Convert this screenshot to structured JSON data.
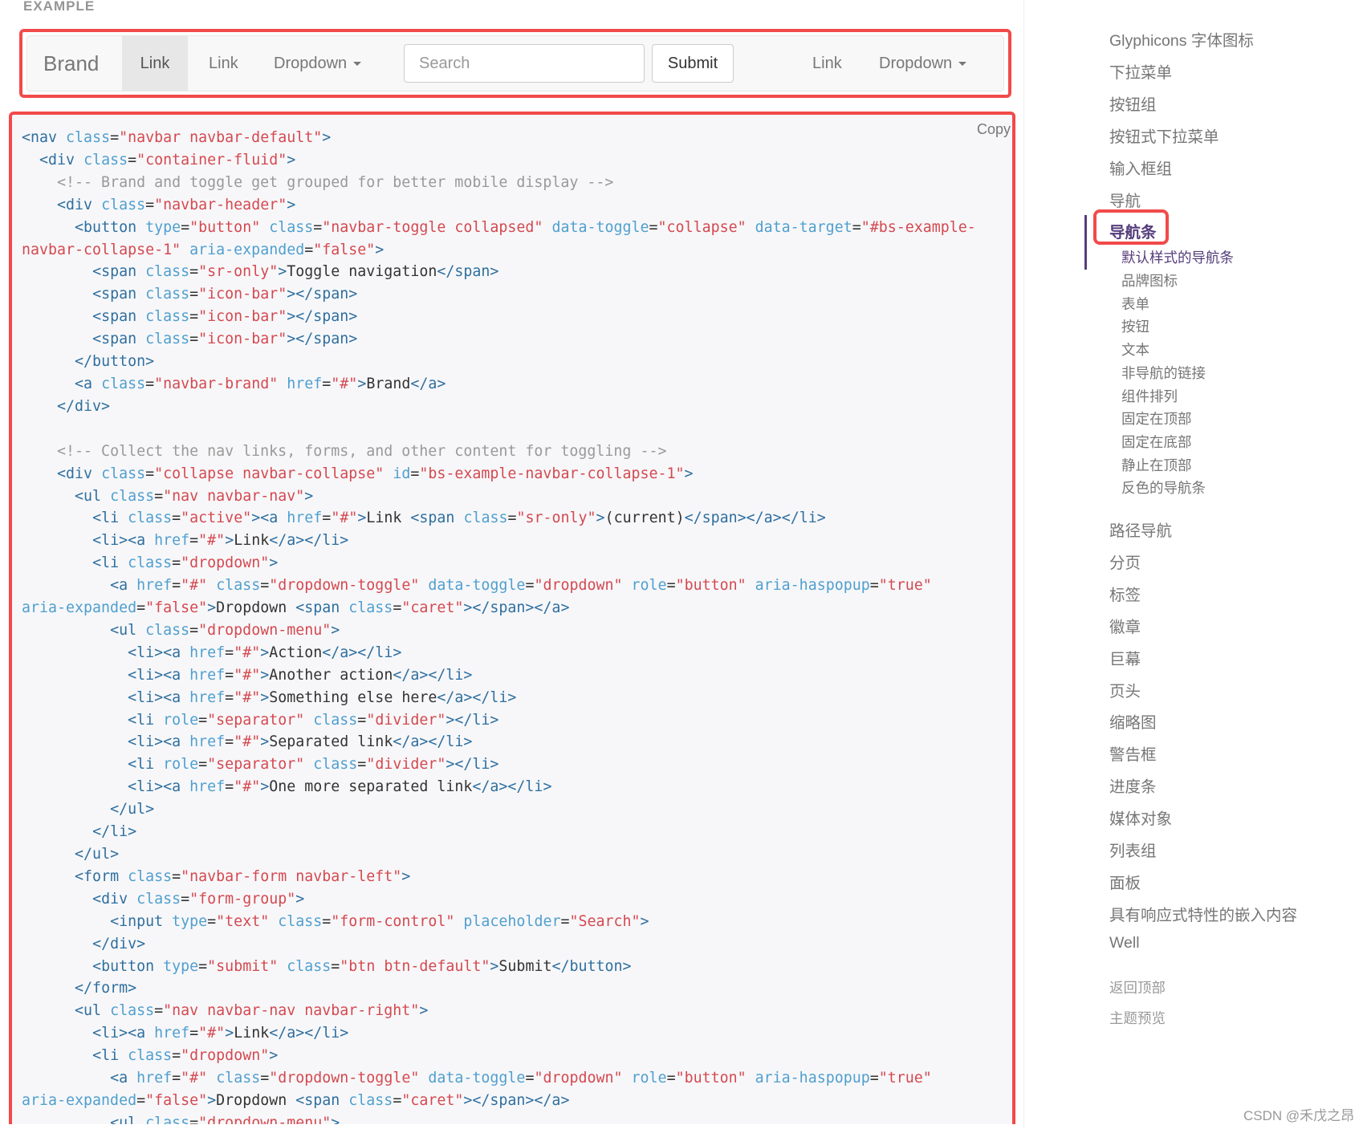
{
  "example_label": "EXAMPLE",
  "navbar": {
    "brand": "Brand",
    "links_left": [
      "Link",
      "Link"
    ],
    "dropdown_left": "Dropdown",
    "search_placeholder": "Search",
    "submit": "Submit",
    "link_right": "Link",
    "dropdown_right": "Dropdown"
  },
  "code": {
    "copy_label": "Copy",
    "lines": [
      "<nav class=\"navbar navbar-default\">",
      "  <div class=\"container-fluid\">",
      "    <!-- Brand and toggle get grouped for better mobile display -->",
      "    <div class=\"navbar-header\">",
      "      <button type=\"button\" class=\"navbar-toggle collapsed\" data-toggle=\"collapse\" data-target=\"#bs-example-",
      "navbar-collapse-1\" aria-expanded=\"false\">",
      "        <span class=\"sr-only\">Toggle navigation</span>",
      "        <span class=\"icon-bar\"></span>",
      "        <span class=\"icon-bar\"></span>",
      "        <span class=\"icon-bar\"></span>",
      "      </button>",
      "      <a class=\"navbar-brand\" href=\"#\">Brand</a>",
      "    </div>",
      "",
      "    <!-- Collect the nav links, forms, and other content for toggling -->",
      "    <div class=\"collapse navbar-collapse\" id=\"bs-example-navbar-collapse-1\">",
      "      <ul class=\"nav navbar-nav\">",
      "        <li class=\"active\"><a href=\"#\">Link <span class=\"sr-only\">(current)</span></a></li>",
      "        <li><a href=\"#\">Link</a></li>",
      "        <li class=\"dropdown\">",
      "          <a href=\"#\" class=\"dropdown-toggle\" data-toggle=\"dropdown\" role=\"button\" aria-haspopup=\"true\"",
      "aria-expanded=\"false\">Dropdown <span class=\"caret\"></span></a>",
      "          <ul class=\"dropdown-menu\">",
      "            <li><a href=\"#\">Action</a></li>",
      "            <li><a href=\"#\">Another action</a></li>",
      "            <li><a href=\"#\">Something else here</a></li>",
      "            <li role=\"separator\" class=\"divider\"></li>",
      "            <li><a href=\"#\">Separated link</a></li>",
      "            <li role=\"separator\" class=\"divider\"></li>",
      "            <li><a href=\"#\">One more separated link</a></li>",
      "          </ul>",
      "        </li>",
      "      </ul>",
      "      <form class=\"navbar-form navbar-left\">",
      "        <div class=\"form-group\">",
      "          <input type=\"text\" class=\"form-control\" placeholder=\"Search\">",
      "        </div>",
      "        <button type=\"submit\" class=\"btn btn-default\">Submit</button>",
      "      </form>",
      "      <ul class=\"nav navbar-nav navbar-right\">",
      "        <li><a href=\"#\">Link</a></li>",
      "        <li class=\"dropdown\">",
      "          <a href=\"#\" class=\"dropdown-toggle\" data-toggle=\"dropdown\" role=\"button\" aria-haspopup=\"true\"",
      "aria-expanded=\"false\">Dropdown <span class=\"caret\"></span></a>",
      "          <ul class=\"dropdown-menu\">"
    ],
    "colors": {
      "tag": "#2f6f9f",
      "attr": "#4f9fcf",
      "string": "#d44950",
      "comment": "#999999",
      "text": "#333333"
    }
  },
  "sidebar": {
    "items_top": [
      "Glyphicons 字体图标",
      "下拉菜单",
      "按钮组",
      "按钮式下拉菜单",
      "输入框组",
      "导航"
    ],
    "active_item": "导航条",
    "active_sub": "默认样式的导航条",
    "sub_items": [
      "品牌图标",
      "表单",
      "按钮",
      "文本",
      "非导航的链接",
      "组件排列",
      "固定在顶部",
      "固定在底部",
      "静止在顶部",
      "反色的导航条"
    ],
    "items_bottom": [
      "路径导航",
      "分页",
      "标签",
      "徽章",
      "巨幕",
      "页头",
      "缩略图",
      "警告框",
      "进度条",
      "媒体对象",
      "列表组",
      "面板",
      "具有响应式特性的嵌入内容",
      "Well"
    ],
    "back_to_top": "返回顶部",
    "theme_preview": "主题预览",
    "accent_color": "#563d7c",
    "highlight_color": "#f24a4a"
  },
  "watermark": "CSDN @禾戊之昂"
}
